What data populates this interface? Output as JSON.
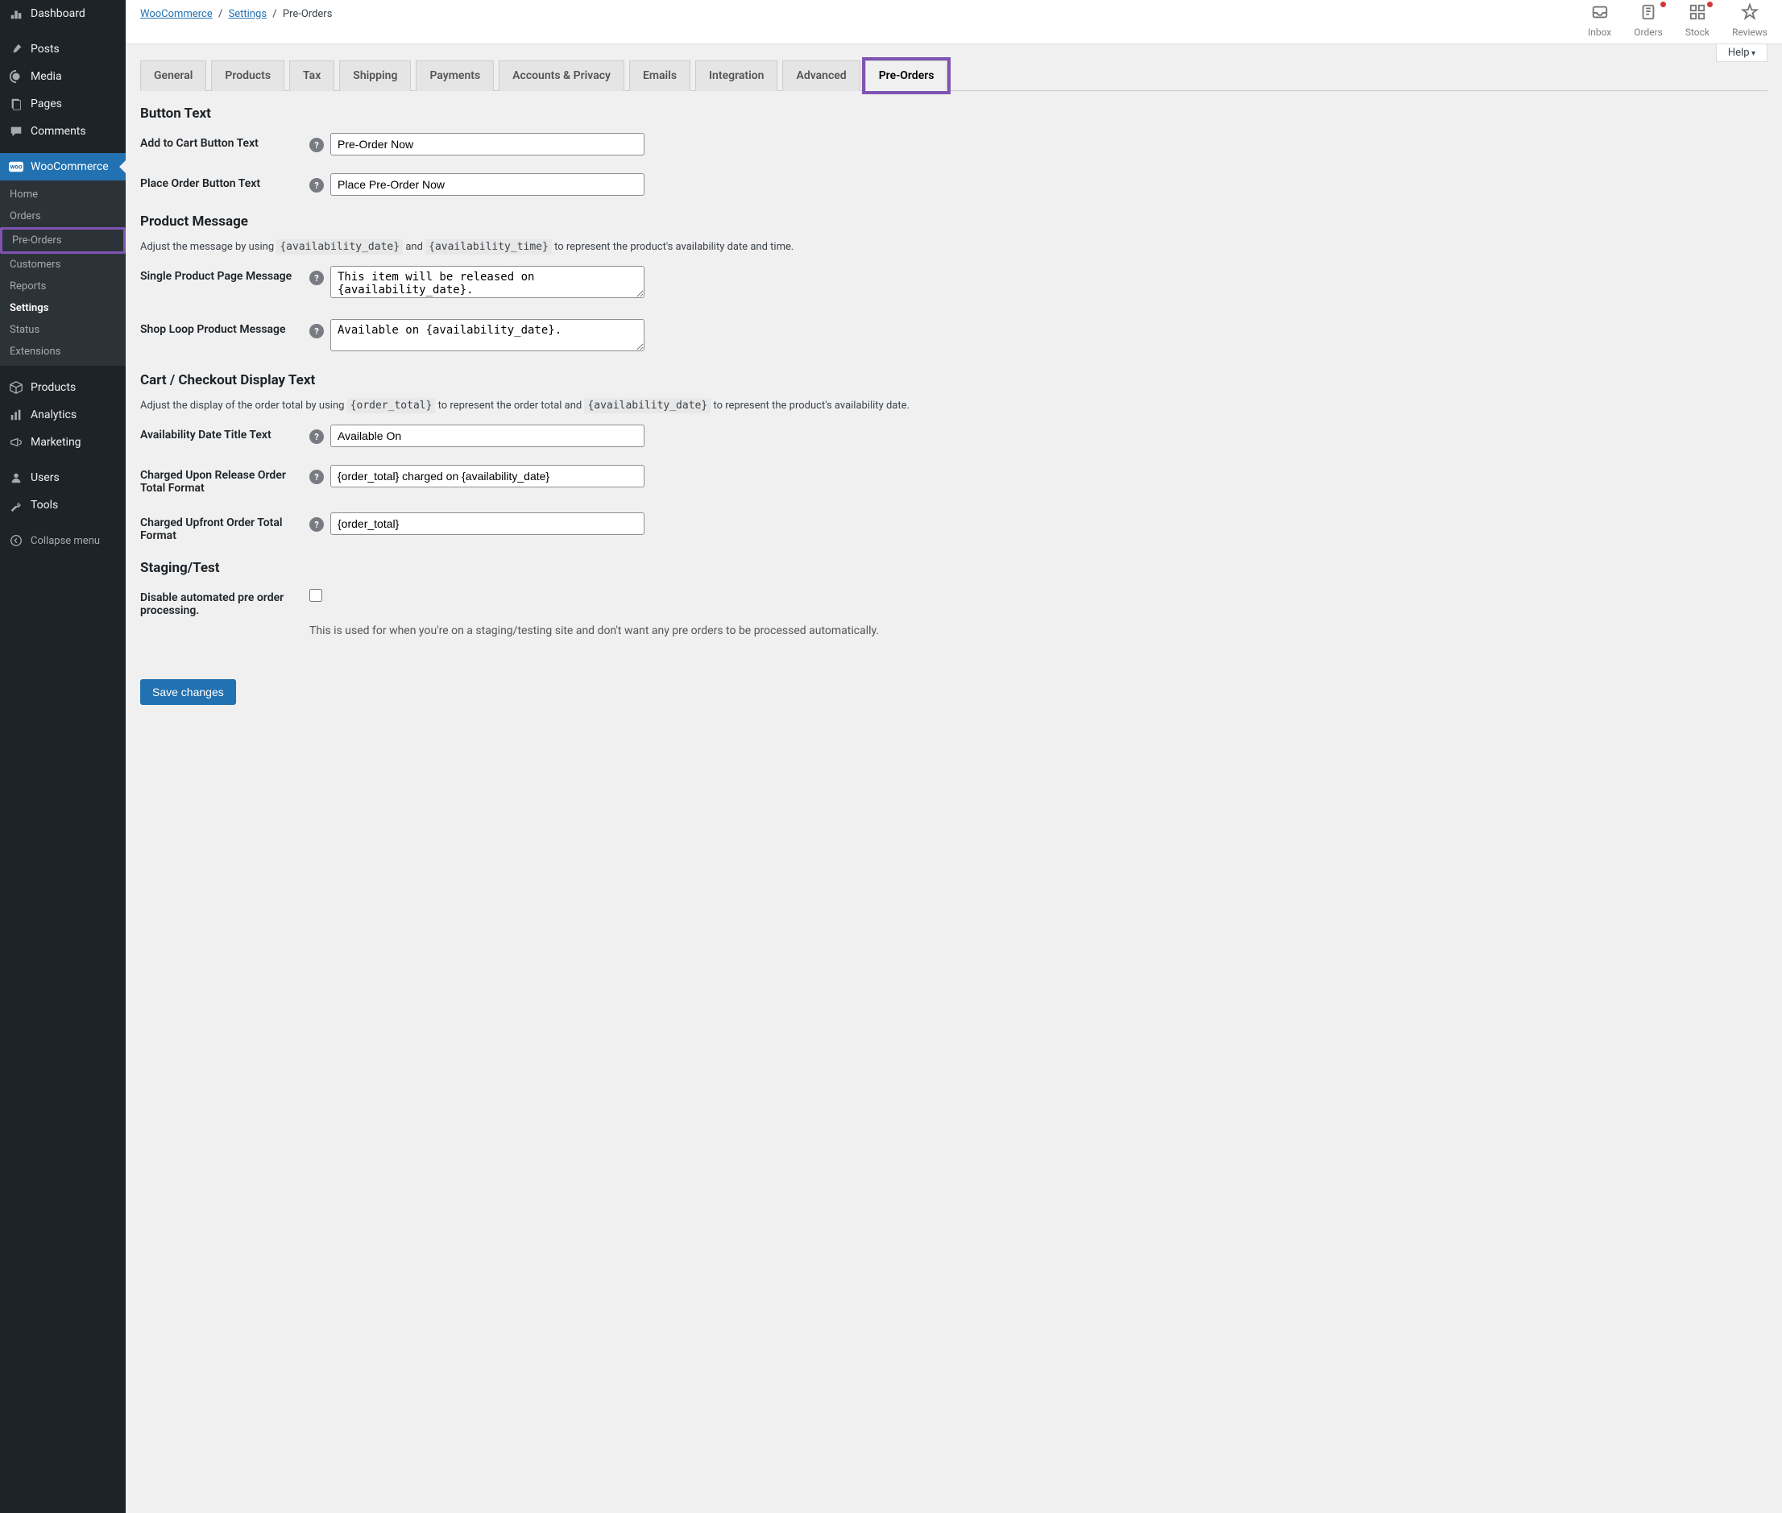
{
  "sidebar": {
    "items": [
      {
        "icon": "dashboard",
        "label": "Dashboard"
      },
      {
        "icon": "pin",
        "label": "Posts"
      },
      {
        "icon": "media",
        "label": "Media"
      },
      {
        "icon": "pages",
        "label": "Pages"
      },
      {
        "icon": "comment",
        "label": "Comments"
      },
      {
        "icon": "woo",
        "label": "WooCommerce",
        "active": true
      },
      {
        "icon": "box",
        "label": "Products"
      },
      {
        "icon": "chart",
        "label": "Analytics"
      },
      {
        "icon": "megaphone",
        "label": "Marketing"
      },
      {
        "icon": "user",
        "label": "Users"
      },
      {
        "icon": "wrench",
        "label": "Tools"
      },
      {
        "icon": "collapse",
        "label": "Collapse menu"
      }
    ],
    "submenu": [
      {
        "label": "Home"
      },
      {
        "label": "Orders"
      },
      {
        "label": "Pre-Orders",
        "highlight": true
      },
      {
        "label": "Customers"
      },
      {
        "label": "Reports"
      },
      {
        "label": "Settings",
        "current": true
      },
      {
        "label": "Status"
      },
      {
        "label": "Extensions"
      }
    ]
  },
  "breadcrumb": {
    "woo": "WooCommerce",
    "settings": "Settings",
    "current": "Pre-Orders"
  },
  "topicons": [
    {
      "name": "inbox",
      "label": "Inbox",
      "dot": false
    },
    {
      "name": "orders",
      "label": "Orders",
      "dot": true
    },
    {
      "name": "stock",
      "label": "Stock",
      "dot": true
    },
    {
      "name": "reviews",
      "label": "Reviews",
      "dot": false
    }
  ],
  "help_label": "Help",
  "tabs": [
    "General",
    "Products",
    "Tax",
    "Shipping",
    "Payments",
    "Accounts & Privacy",
    "Emails",
    "Integration",
    "Advanced",
    "Pre-Orders"
  ],
  "active_tab_index": 9,
  "sections": {
    "button_text": {
      "heading": "Button Text",
      "fields": [
        {
          "label": "Add to Cart Button Text",
          "value": "Pre-Order Now"
        },
        {
          "label": "Place Order Button Text",
          "value": "Place Pre-Order Now"
        }
      ]
    },
    "product_message": {
      "heading": "Product Message",
      "desc_pre": "Adjust the message by using ",
      "token1": "{availability_date}",
      "desc_mid": " and ",
      "token2": "{availability_time}",
      "desc_post": " to represent the product's availability date and time.",
      "fields": [
        {
          "label": "Single Product Page Message",
          "value": "This item will be released on {availability_date}.",
          "textarea": true
        },
        {
          "label": "Shop Loop Product Message",
          "value": "Available on {availability_date}.",
          "textarea": true
        }
      ]
    },
    "cart_checkout": {
      "heading": "Cart / Checkout Display Text",
      "desc_pre": "Adjust the display of the order total by using ",
      "token1": "{order_total}",
      "desc_mid": " to represent the order total and ",
      "token2": "{availability_date}",
      "desc_post": " to represent the product's availability date.",
      "fields": [
        {
          "label": "Availability Date Title Text",
          "value": "Available On"
        },
        {
          "label": "Charged Upon Release Order Total Format",
          "value": "{order_total} charged on {availability_date}"
        },
        {
          "label": "Charged Upfront Order Total Format",
          "value": "{order_total}"
        }
      ]
    },
    "staging": {
      "heading": "Staging/Test",
      "checkbox_label": "Disable automated pre order processing.",
      "checkbox_desc": "This is used for when you're on a staging/testing site and don't want any pre orders to be processed automatically."
    }
  },
  "save_label": "Save changes"
}
